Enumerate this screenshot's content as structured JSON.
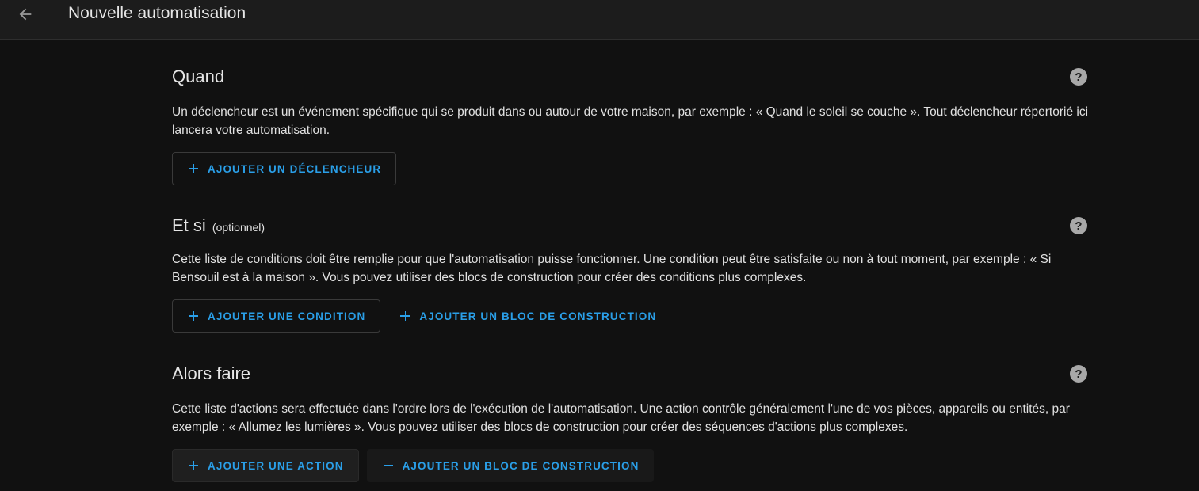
{
  "header": {
    "title": "Nouvelle automatisation"
  },
  "sections": {
    "trigger": {
      "title": "Quand",
      "description": "Un déclencheur est un événement spécifique qui se produit dans ou autour de votre maison, par exemple : « Quand le soleil se couche ». Tout déclencheur répertorié ici lancera votre automatisation.",
      "add_trigger_label": "AJOUTER UN DÉCLENCHEUR"
    },
    "condition": {
      "title": "Et si",
      "optional": "(optionnel)",
      "description": "Cette liste de conditions doit être remplie pour que l'automatisation puisse fonctionner. Une condition peut être satisfaite ou non à tout moment, par exemple : « Si Bensouil est à la maison ». Vous pouvez utiliser des blocs de construction pour créer des conditions plus complexes.",
      "add_condition_label": "AJOUTER UNE CONDITION",
      "add_block_label": "AJOUTER UN BLOC DE CONSTRUCTION"
    },
    "action": {
      "title": "Alors faire",
      "description": "Cette liste d'actions sera effectuée dans l'ordre lors de l'exécution de l'automatisation. Une action contrôle généralement l'une de vos pièces, appareils ou entités, par exemple : « Allumez les lumières ». Vous pouvez utiliser des blocs de construction pour créer des séquences d'actions plus complexes.",
      "add_action_label": "AJOUTER UNE ACTION",
      "add_block_label": "AJOUTER UN BLOC DE CONSTRUCTION"
    }
  },
  "icons": {
    "back": "arrow-left-icon",
    "help": "help-circle-icon",
    "add": "plus-icon"
  },
  "colors": {
    "background": "#111111",
    "header": "#1c1c1c",
    "accent": "#2a9fe8",
    "text": "#e1e1e1"
  }
}
